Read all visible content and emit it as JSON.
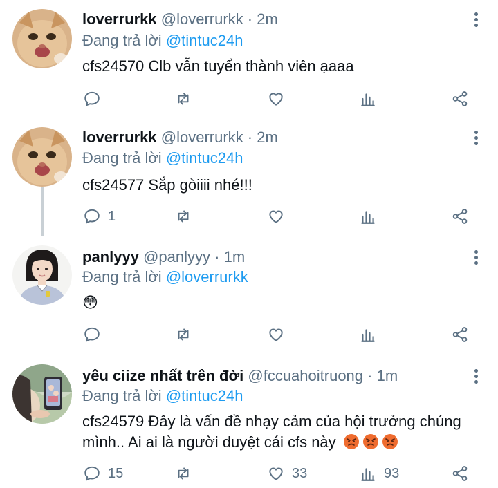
{
  "tweets": [
    {
      "name": "loverrurkk",
      "handle": "@loverrurkk",
      "dot": "·",
      "time": "2m",
      "reply_prefix": "Đang trả lời ",
      "reply_to": "@tintuc24h",
      "text": "cfs24570 Clb vẫn tuyển thành viên ạaaa",
      "reply_count": "",
      "retweet_count": "",
      "like_count": "",
      "view_count": ""
    },
    {
      "name": "loverrurkk",
      "handle": "@loverrurkk",
      "dot": "·",
      "time": "2m",
      "reply_prefix": "Đang trả lời ",
      "reply_to": "@tintuc24h",
      "text": "cfs24577 Sắp gòiiii nhé!!!",
      "reply_count": "1",
      "retweet_count": "",
      "like_count": "",
      "view_count": ""
    },
    {
      "name": "panlyyy",
      "handle": "@panlyyy",
      "dot": "·",
      "time": "1m",
      "reply_prefix": "Đang trả lời ",
      "reply_to": "@loverrurkk",
      "text": "😳",
      "reply_count": "",
      "retweet_count": "",
      "like_count": "",
      "view_count": ""
    },
    {
      "name": "yêu ciize nhất trên đời",
      "handle": "@fccuahoitruong",
      "dot": "·",
      "time": "1m",
      "reply_prefix": "Đang trả lời ",
      "reply_to": "@tintuc24h",
      "text": "cfs24579 Đây là vấn đề nhạy cảm của hội trưởng chúng mình.. Ai ai là người duyệt cái cfs này",
      "reply_count": "15",
      "retweet_count": "",
      "like_count": "33",
      "view_count": "93"
    }
  ],
  "icons": {
    "reply": "reply-icon",
    "retweet": "retweet-icon",
    "like": "heart-icon",
    "views": "analytics-icon",
    "share": "share-icon",
    "more": "more-vertical-icon",
    "angry_emoji": "angry-face-emoji"
  },
  "colors": {
    "mention": "#1d9bf0",
    "secondary_text": "#5b7083",
    "primary_text": "#0f1419",
    "divider": "#e1e4e6",
    "thread_line": "#c9d0d5",
    "angry_emoji": "#ef6c2f"
  }
}
